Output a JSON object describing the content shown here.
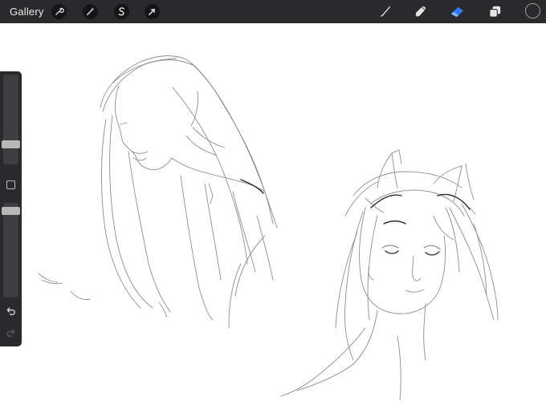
{
  "topbar": {
    "gallery_label": "Gallery",
    "left_tools": [
      {
        "name": "actions",
        "icon": "wrench-icon"
      },
      {
        "name": "adjustments",
        "icon": "magic-wand-icon"
      },
      {
        "name": "selection",
        "icon": "selection-s-icon"
      },
      {
        "name": "transform",
        "icon": "arrow-cursor-icon"
      }
    ],
    "right_tools": [
      {
        "name": "brush",
        "icon": "brush-icon",
        "active": false
      },
      {
        "name": "smudge",
        "icon": "smudge-icon",
        "active": false
      },
      {
        "name": "eraser",
        "icon": "eraser-icon",
        "active": true
      },
      {
        "name": "layers",
        "icon": "layers-icon",
        "active": false
      }
    ],
    "color_swatch": "#2a2a2c"
  },
  "sidebar": {
    "brush_size_level": 0.2,
    "opacity_level": 0.95,
    "modify_icon": "square-icon",
    "undo_icon": "undo-icon",
    "redo_icon": "redo-icon"
  },
  "colors": {
    "toolbar_bg": "#2a2a2c",
    "active_tool": "#2f7bf5",
    "icon": "#e6e6e6",
    "canvas": "#ffffff",
    "sketch": "#6e6e6e"
  }
}
